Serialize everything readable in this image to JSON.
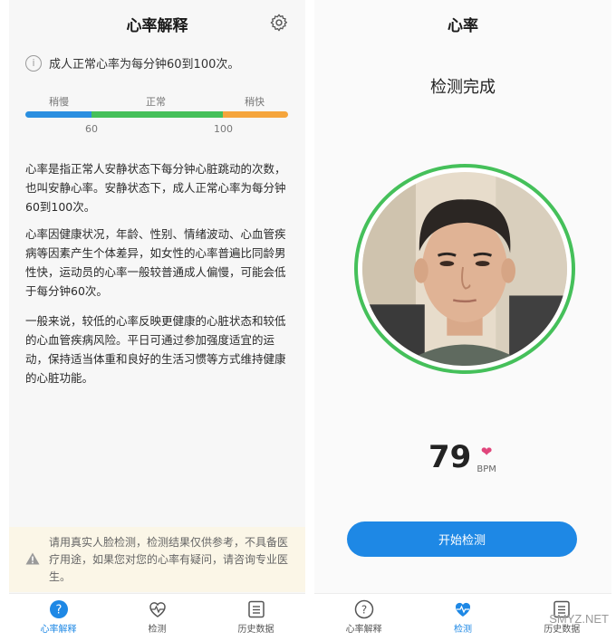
{
  "left": {
    "title": "心率解释",
    "info": "成人正常心率为每分钟60到100次。",
    "range": {
      "slow": "稍慢",
      "normal": "正常",
      "fast": "稍快",
      "tick_low": "60",
      "tick_high": "100"
    },
    "paragraphs": [
      "心率是指正常人安静状态下每分钟心脏跳动的次数，也叫安静心率。安静状态下，成人正常心率为每分钟60到100次。",
      "心率因健康状况，年龄、性别、情绪波动、心血管疾病等因素产生个体差异，如女性的心率普遍比同龄男性快，运动员的心率一般较普通成人偏慢，可能会低于每分钟60次。",
      "一般来说，较低的心率反映更健康的心脏状态和较低的心血管疾病风险。平日可通过参加强度适宜的运动，保持适当体重和良好的生活习惯等方式维持健康的心脏功能。"
    ],
    "warning": "请用真实人脸检测，检测结果仅供参考，不具备医疗用途，如果您对您的心率有疑问，请咨询专业医生。",
    "tabs": [
      {
        "label": "心率解释",
        "icon": "question-circle-icon"
      },
      {
        "label": "检测",
        "icon": "heartbeat-icon"
      },
      {
        "label": "历史数据",
        "icon": "list-icon"
      }
    ]
  },
  "right": {
    "title": "心率",
    "status": "检测完成",
    "bpm_value": "79",
    "bpm_unit": "BPM",
    "start_button": "开始检测",
    "tabs": [
      {
        "label": "心率解释",
        "icon": "question-circle-icon"
      },
      {
        "label": "检测",
        "icon": "heartbeat-icon"
      },
      {
        "label": "历史数据",
        "icon": "list-icon"
      }
    ]
  },
  "watermark": "SMYZ.NET",
  "colors": {
    "accent": "#1e88e5",
    "normal": "#45c05a",
    "slow": "#2a8fe0",
    "fast": "#f5a53c",
    "heart": "#e0457b"
  }
}
